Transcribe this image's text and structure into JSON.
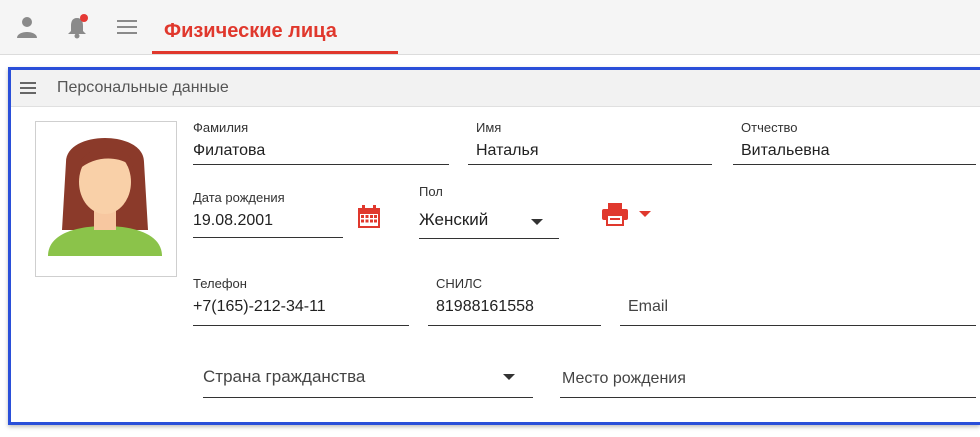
{
  "toolbar": {
    "title": "Физические лица",
    "icons": [
      "user-icon",
      "bell-icon",
      "menu-icon"
    ],
    "accent_color": "#e0382d",
    "notification_dot_color": "#e53935"
  },
  "panel": {
    "title": "Персональные данные",
    "highlight_color": "#2a4fd9"
  },
  "fields": {
    "last_name": {
      "label": "Фамилия",
      "value": "Филатова"
    },
    "first_name": {
      "label": "Имя",
      "value": "Наталья"
    },
    "patronymic": {
      "label": "Отчество",
      "value": "Витальевна"
    },
    "birth_date": {
      "label": "Дата рождения",
      "value": "19.08.2001"
    },
    "gender": {
      "label": "Пол",
      "value": "Женский"
    },
    "phone": {
      "label": "Телефон",
      "value": "+7(165)-212-34-11"
    },
    "snils": {
      "label": "СНИЛС",
      "value": "81988161558"
    },
    "email": {
      "placeholder": "Email"
    },
    "citizenship": {
      "placeholder": "Страна гражданства"
    },
    "birth_place": {
      "placeholder": "Место рождения"
    }
  },
  "icons": {
    "calendar": "calendar-icon",
    "print": "printer-icon",
    "dropdown": "chevron-down-icon"
  }
}
